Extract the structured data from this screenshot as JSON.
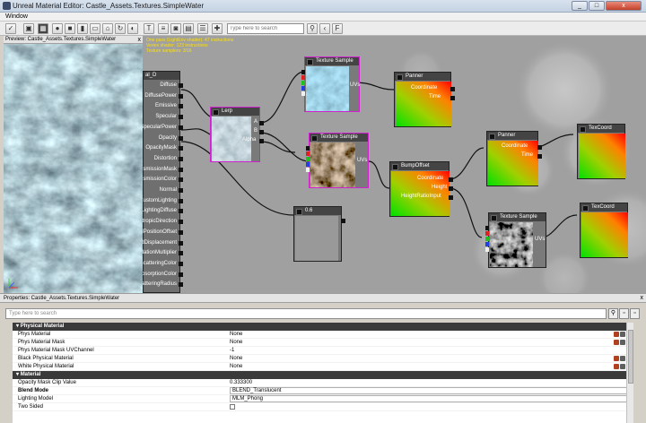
{
  "window": {
    "title": "Unreal Material Editor: Castle_Assets.Textures.SimpleWater",
    "min": "_",
    "max": "□",
    "close": "x"
  },
  "menu": {
    "window": "Window"
  },
  "toolbar": {
    "search_placeholder": "Type here to search"
  },
  "preview": {
    "title": "Preview: Castle_Assets.Textures.SimpleWater",
    "close": "x"
  },
  "graph": {
    "stats": [
      "One pass (LightEnv shader): 47 instructions",
      "Vertex shader: 123 instructions",
      "Texture samplers: 3/16"
    ],
    "result_node": {
      "title": "al_D",
      "inputs": [
        "Diffuse",
        "DiffusePower",
        "Emissive",
        "Specular",
        "SpecularPower",
        "Opacity",
        "OpacityMask",
        "Distortion",
        "TransmissionMask",
        "TransmissionColor",
        "Normal",
        "CustomLighting",
        "CustomLightingDiffuse",
        "AnisotropicDirection",
        "WorldPositionOffset",
        "WorldDisplacement",
        "TessellationMultiplier",
        "SubsurfaceInscatteringColor",
        "SubsurfaceAbsorptionColor",
        "SubsurfaceScatteringRadius"
      ]
    },
    "nodes": {
      "lerp": {
        "title": "Lerp",
        "in_a": "A",
        "in_b": "B",
        "in_alpha": "Alpha"
      },
      "tex1": {
        "title": "Texture Sample",
        "uvs": "UVs"
      },
      "tex2": {
        "title": "Texture Sample",
        "uvs": "UVs"
      },
      "tex3": {
        "title": "Texture Sample",
        "uvs": "UVs"
      },
      "panner1": {
        "title": "Panner",
        "coord": "Coordinate",
        "time": "Time"
      },
      "panner2": {
        "title": "Panner",
        "coord": "Coordinate",
        "time": "Time"
      },
      "texcoord1": {
        "title": "TexCoord"
      },
      "texcoord2": {
        "title": "TexCoord"
      },
      "bump": {
        "title": "BumpOffset",
        "coord": "Coordinate",
        "height": "Height",
        "ratio": "HeightRatioInput"
      },
      "constant": {
        "title": "0.6"
      }
    }
  },
  "properties": {
    "title": "Properties: Castle_Assets.Textures.SimpleWater",
    "close": "x",
    "search_placeholder": "Type here to search",
    "categories": [
      {
        "name": "Physical Material",
        "rows": [
          {
            "key": "Phys Material",
            "value": "None",
            "icons": true,
            "bold": false
          },
          {
            "key": "Phys Material Mask",
            "value": "None",
            "icons": true,
            "bold": false
          },
          {
            "key": "Phys Material Mask UVChannel",
            "value": "-1",
            "icons": false,
            "bold": false
          },
          {
            "key": "Black Physical Material",
            "value": "None",
            "icons": true,
            "bold": false
          },
          {
            "key": "White Physical Material",
            "value": "None",
            "icons": true,
            "bold": false
          }
        ]
      },
      {
        "name": "Material",
        "rows": [
          {
            "key": "Opacity Mask Clip Value",
            "value": "0.333300",
            "icons": false,
            "bold": false
          },
          {
            "key": "Blend Mode",
            "value": "BLEND_Translucent",
            "icons": false,
            "bold": true,
            "combo": true
          },
          {
            "key": "Lighting Model",
            "value": "MLM_Phong",
            "icons": false,
            "bold": false,
            "combo": true
          },
          {
            "key": "Two Sided",
            "value": "",
            "icons": false,
            "bold": false
          }
        ]
      }
    ]
  },
  "colors": {
    "selection": "#d020d0",
    "stats_text": "#ffe000",
    "node_header": "#444444"
  }
}
